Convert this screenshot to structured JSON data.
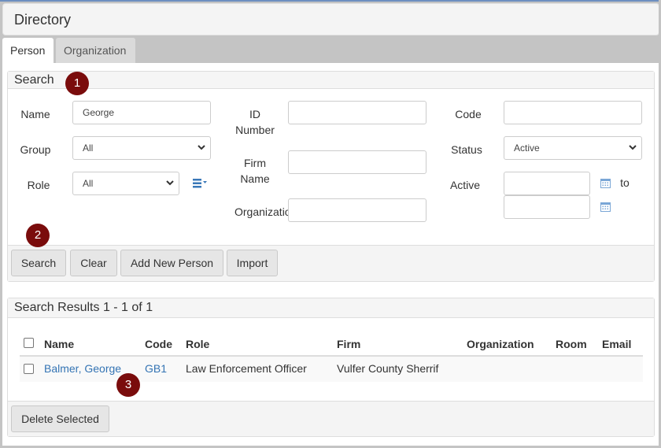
{
  "header": {
    "title": "Directory"
  },
  "tabs": [
    {
      "label": "Person",
      "active": true
    },
    {
      "label": "Organization",
      "active": false
    }
  ],
  "search_panel": {
    "title": "Search",
    "fields": {
      "name": {
        "label": "Name",
        "value": "George",
        "placeholder": ""
      },
      "group": {
        "label": "Group",
        "selected": "All"
      },
      "role": {
        "label": "Role",
        "selected": "All"
      },
      "id_number": {
        "label_line1": "ID",
        "label_line2": "Number",
        "value": ""
      },
      "firm_name": {
        "label_line1": "Firm",
        "label_line2": "Name",
        "value": ""
      },
      "organization": {
        "label": "Organizatio",
        "value": ""
      },
      "code": {
        "label": "Code",
        "value": ""
      },
      "status": {
        "label": "Status",
        "selected": "Active"
      },
      "active": {
        "label": "Active",
        "from_value": "",
        "to_label": "to",
        "to_value": ""
      }
    },
    "buttons": {
      "search": "Search",
      "clear": "Clear",
      "add_new_person": "Add New Person",
      "import": "Import"
    }
  },
  "annotations": [
    "1",
    "2",
    "3"
  ],
  "results_panel": {
    "title": "Search Results 1 - 1 of 1",
    "columns": [
      "Name",
      "Code",
      "Role",
      "Firm",
      "Organization",
      "Room",
      "Email"
    ],
    "rows": [
      {
        "name": "Balmer, George",
        "code": "GB1",
        "role": "Law Enforcement Officer",
        "firm": "Vulfer County Sherrif",
        "organization": "",
        "room": "",
        "email": ""
      }
    ],
    "buttons": {
      "delete_selected": "Delete Selected"
    }
  },
  "colors": {
    "accent_badge": "#7a0c0c",
    "link": "#3474b4",
    "icon_blue": "#3a78b8"
  }
}
